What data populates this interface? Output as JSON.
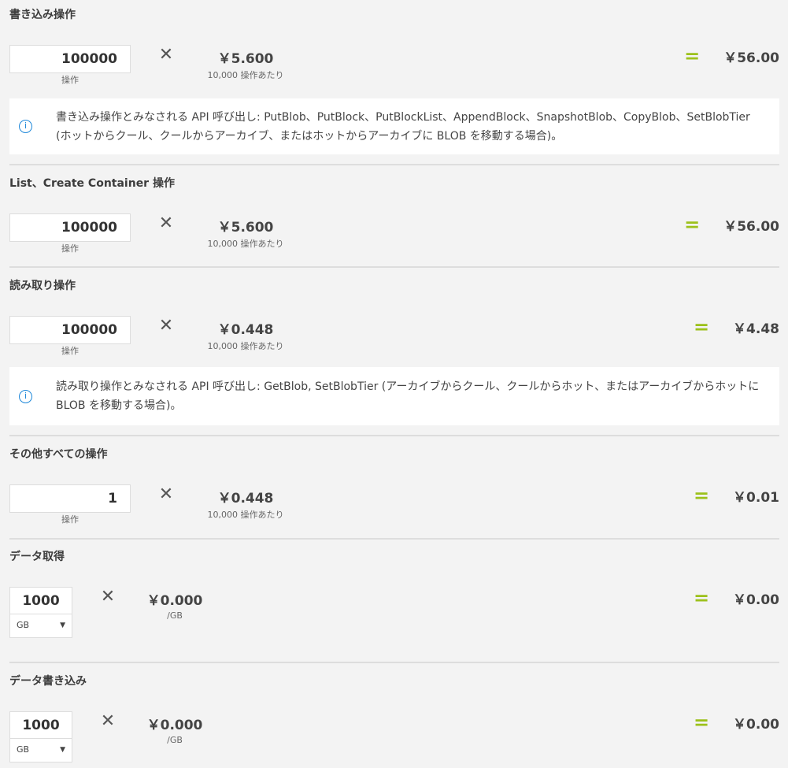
{
  "sections": [
    {
      "title": "書き込み操作",
      "quantity": "100000",
      "unit": "操作",
      "price": "￥5.600",
      "per": "10,000 操作あたり",
      "total": "￥56.00",
      "info": "書き込み操作とみなされる API 呼び出し: PutBlob、PutBlock、PutBlockList、AppendBlock、SnapshotBlob、CopyBlob、SetBlobTier (ホットからクール、クールからアーカイブ、またはホットからアーカイブに BLOB を移動する場合)。"
    },
    {
      "title": "List、Create Container 操作",
      "quantity": "100000",
      "unit": "操作",
      "price": "￥5.600",
      "per": "10,000 操作あたり",
      "total": "￥56.00"
    },
    {
      "title": "読み取り操作",
      "quantity": "100000",
      "unit": "操作",
      "price": "￥0.448",
      "per": "10,000 操作あたり",
      "total": "￥4.48",
      "info": "読み取り操作とみなされる API 呼び出し: GetBlob, SetBlobTier (アーカイブからクール、クールからホット、またはアーカイブからホットに BLOB を移動する場合)。"
    },
    {
      "title": "その他すべての操作",
      "quantity": "1",
      "unit": "操作",
      "price": "￥0.448",
      "per": "10,000 操作あたり",
      "total": "￥0.01"
    },
    {
      "title": "データ取得",
      "quantity": "1000",
      "unit_select": "GB",
      "price": "￥0.000",
      "per": "/GB",
      "total": "￥0.00"
    },
    {
      "title": "データ書き込み",
      "quantity": "1000",
      "unit_select": "GB",
      "price": "￥0.000",
      "per": "/GB",
      "total": "￥0.00"
    }
  ],
  "symbols": {
    "times": "✕",
    "equals": "=",
    "info": "i",
    "dropdown": "▼"
  }
}
